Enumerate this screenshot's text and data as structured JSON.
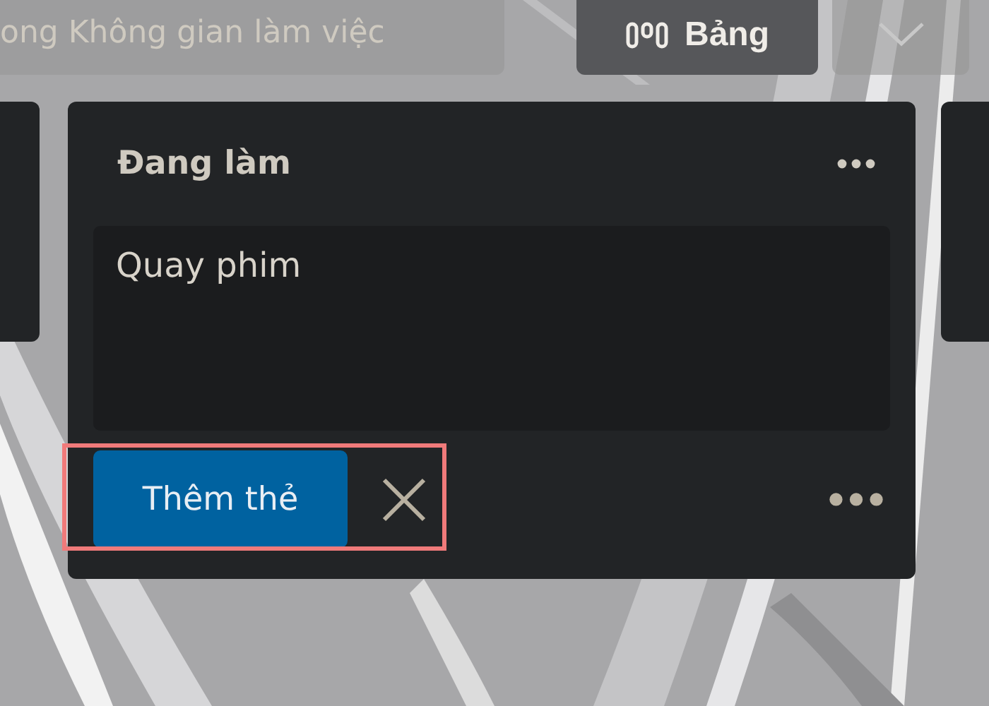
{
  "top_bar": {
    "search": {
      "placeholder": "ong Không gian làm việc"
    },
    "view_button": {
      "label": "Bảng"
    },
    "dropdown": {
      "expanded": false
    }
  },
  "list": {
    "title": "Đang làm",
    "composer": {
      "value": "Quay phim",
      "add_button": "Thêm thẻ",
      "highlighted": true
    }
  }
}
